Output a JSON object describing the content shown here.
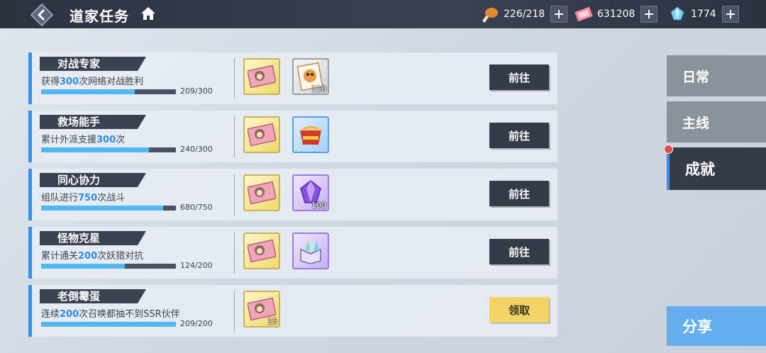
{
  "header": {
    "title": "道家任务",
    "resources": [
      {
        "icon": "drumstick-icon",
        "value": "226/218"
      },
      {
        "icon": "ticket-icon",
        "value": "631208"
      },
      {
        "icon": "crystal-icon",
        "value": "1774"
      }
    ]
  },
  "tasks": [
    {
      "name": "对战专家",
      "desc_pre": "获得",
      "desc_num": "300",
      "desc_post": "次网络对战胜利",
      "progress_text": "209/300",
      "progress": 0.697,
      "rewards": [
        "coupon-card",
        "shikigami-card"
      ],
      "reward_qty": [
        "",
        "110"
      ],
      "action": "前往"
    },
    {
      "name": "救场能手",
      "desc_pre": "累计外派支援",
      "desc_num": "300",
      "desc_post": "次",
      "progress_text": "240/300",
      "progress": 0.8,
      "rewards": [
        "coupon-card",
        "noodle-bowl"
      ],
      "reward_qty": [
        "",
        ""
      ],
      "action": "前往"
    },
    {
      "name": "同心协力",
      "desc_pre": "组队进行",
      "desc_num": "750",
      "desc_post": "次战斗",
      "progress_text": "680/750",
      "progress": 0.907,
      "rewards": [
        "coupon-card",
        "purple-gem"
      ],
      "reward_qty": [
        "",
        "100"
      ],
      "action": "前往"
    },
    {
      "name": "怪物克星",
      "desc_pre": "累计通关",
      "desc_num": "200",
      "desc_post": "次妖猎对抗",
      "progress_text": "124/200",
      "progress": 0.62,
      "rewards": [
        "coupon-card",
        "crystal-box"
      ],
      "reward_qty": [
        "",
        ""
      ],
      "action": "前往"
    },
    {
      "name": "老倒霉蛋",
      "desc_pre": "连续",
      "desc_num": "200",
      "desc_post": "次召唤都抽不到SSR伙伴",
      "progress_text": "209/200",
      "progress": 1.0,
      "rewards": [
        "coupon-card"
      ],
      "reward_qty": [
        "15"
      ],
      "action": "领取"
    }
  ],
  "tabs": [
    {
      "label": "日常",
      "active": false
    },
    {
      "label": "主线",
      "active": false
    },
    {
      "label": "成就",
      "active": true
    }
  ],
  "share_label": "分享",
  "colors": {
    "accent": "#3d8ee6",
    "bar_fill": "#52b8ef",
    "claim": "#f2d466",
    "dark": "#343b48"
  }
}
